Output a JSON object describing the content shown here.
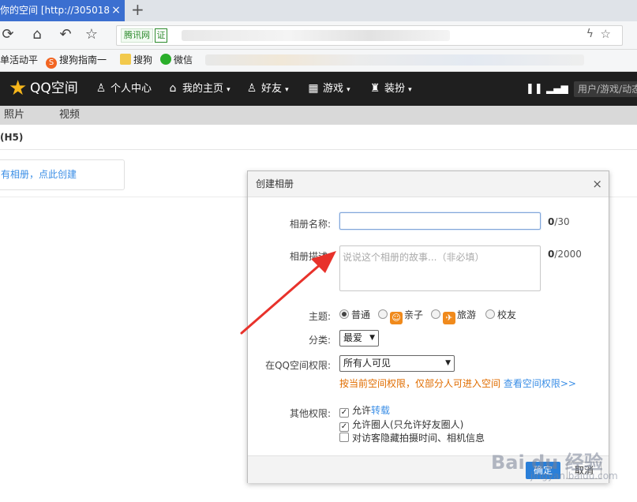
{
  "browser": {
    "tab_title": "你的空间 [http://305018",
    "tab_close": "×",
    "new_tab": "+",
    "site_badge": "腾讯网",
    "cert_badge": "证",
    "icons": [
      "refresh-icon",
      "home-icon",
      "undo-icon",
      "star-icon",
      "lightning-icon",
      "star-icon"
    ]
  },
  "bookmarks": [
    {
      "label": "单活动平",
      "icon": ""
    },
    {
      "label": "搜狗指南一",
      "icon": "S"
    },
    {
      "label": "搜狗",
      "icon": ""
    },
    {
      "label": "微信",
      "icon": ""
    },
    {
      "label": "广门大学",
      "icon": ""
    },
    {
      "label": "质分招农",
      "icon": ""
    }
  ],
  "qqnav": {
    "logo": "QQ空间",
    "items": [
      {
        "label": "个人中心",
        "icon": "person-icon"
      },
      {
        "label": "我的主页",
        "icon": "home-icon",
        "arrow": "▾"
      },
      {
        "label": "好友",
        "icon": "friends-icon",
        "arrow": "▾"
      },
      {
        "label": "游戏",
        "icon": "grid-icon",
        "arrow": "▾"
      },
      {
        "label": "装扮",
        "icon": "shirt-icon",
        "arrow": "▾"
      }
    ],
    "search_placeholder": "用户/游戏/动态"
  },
  "subnav": [
    "照片",
    "视频"
  ],
  "page": {
    "h5_label": "(H5)",
    "create_card": "有相册，点此创建"
  },
  "dialog": {
    "title": "创建相册",
    "close": "×",
    "name_label": "相册名称:",
    "name_value": "",
    "name_count": "0",
    "name_max": "/30",
    "desc_label": "相册描述:",
    "desc_placeholder": "说说这个相册的故事...（非必填）",
    "desc_count": "0",
    "desc_max": "/2000",
    "theme_label": "主题:",
    "themes": [
      {
        "label": "普通",
        "selected": true,
        "thumb": ""
      },
      {
        "label": "亲子",
        "selected": false,
        "thumb": "☺"
      },
      {
        "label": "旅游",
        "selected": false,
        "thumb": "✈"
      },
      {
        "label": "校友",
        "selected": false,
        "thumb": ""
      }
    ],
    "category_label": "分类:",
    "category_value": "最爱",
    "perm_label": "在QQ空间权限:",
    "perm_value": "所有人可见",
    "perm_note": "按当前空间权限，仅部分人可进入空间",
    "perm_link": "查看空间权限>>",
    "other_label": "其他权限:",
    "options": [
      {
        "prefix": "允许",
        "highlight": "转载",
        "suffix": "",
        "checked": true
      },
      {
        "prefix": "允许圈人(只允许好友圈人)",
        "highlight": "",
        "suffix": "",
        "checked": true
      },
      {
        "prefix": "对访客隐藏拍摄时间、相机信息",
        "highlight": "",
        "suffix": "",
        "checked": false
      }
    ],
    "ok": "确定",
    "cancel": "取消"
  },
  "watermark": {
    "text": "Bai du 经验",
    "sub": "jingyan.baidu.com"
  },
  "colors": {
    "accent": "#2a7fd8",
    "warning": "#e06d00",
    "link": "#3a8ee6",
    "nav_bg": "#1f1f1f",
    "annotation": "#e8322b"
  }
}
